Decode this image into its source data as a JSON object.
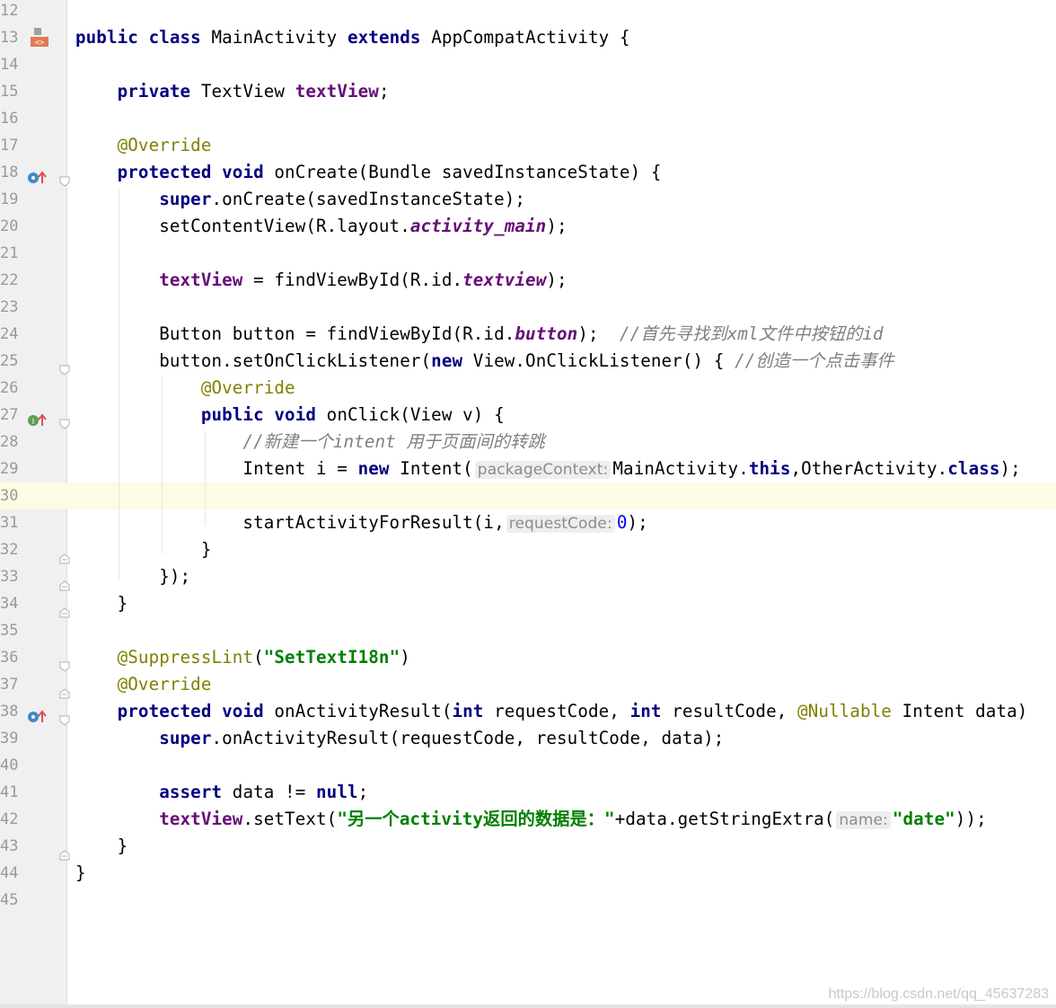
{
  "editor": {
    "first_line_number": 12,
    "current_line": 30,
    "lines": [
      {
        "n": "12",
        "tokens": []
      },
      {
        "n": "13",
        "tokens": [
          [
            "kw",
            "public"
          ],
          [
            "",
            " "
          ],
          [
            "kw",
            "class"
          ],
          [
            "",
            " MainActivity "
          ],
          [
            "kw",
            "extends"
          ],
          [
            "",
            " AppCompatActivity {"
          ]
        ],
        "gutter": "class-icon"
      },
      {
        "n": "14",
        "tokens": []
      },
      {
        "n": "15",
        "tokens": [
          [
            "",
            "    "
          ],
          [
            "kw",
            "private"
          ],
          [
            "",
            " TextView "
          ],
          [
            "field",
            "textView"
          ],
          [
            "",
            ";"
          ]
        ]
      },
      {
        "n": "16",
        "tokens": []
      },
      {
        "n": "17",
        "tokens": [
          [
            "",
            "    "
          ],
          [
            "ann",
            "@Override"
          ]
        ]
      },
      {
        "n": "18",
        "tokens": [
          [
            "",
            "    "
          ],
          [
            "kw",
            "protected"
          ],
          [
            "",
            " "
          ],
          [
            "kw",
            "void"
          ],
          [
            "",
            " onCreate(Bundle savedInstanceState) {"
          ]
        ],
        "gutter": "override-icon",
        "fold": "fold-open"
      },
      {
        "n": "19",
        "tokens": [
          [
            "",
            "        "
          ],
          [
            "kw",
            "super"
          ],
          [
            "",
            ".onCreate(savedInstanceState);"
          ]
        ]
      },
      {
        "n": "20",
        "tokens": [
          [
            "",
            "        setContentView(R.layout."
          ],
          [
            "sfield",
            "activity_main"
          ],
          [
            "",
            ");"
          ]
        ]
      },
      {
        "n": "21",
        "tokens": []
      },
      {
        "n": "22",
        "tokens": [
          [
            "",
            "        "
          ],
          [
            "field",
            "textView"
          ],
          [
            "",
            " = findViewById(R.id."
          ],
          [
            "sfield",
            "textview"
          ],
          [
            "",
            ");"
          ]
        ]
      },
      {
        "n": "23",
        "tokens": []
      },
      {
        "n": "24",
        "tokens": [
          [
            "",
            "        Button button = findViewById(R.id."
          ],
          [
            "sfield",
            "button"
          ],
          [
            "",
            ");  "
          ],
          [
            "cm",
            "//首先寻找到xml文件中按钮的id"
          ]
        ]
      },
      {
        "n": "25",
        "tokens": [
          [
            "",
            "        button.setOnClickListener("
          ],
          [
            "kw",
            "new"
          ],
          [
            "",
            " View.OnClickListener() { "
          ],
          [
            "cm",
            "//创造一个点击事件"
          ]
        ],
        "fold": "fold-open"
      },
      {
        "n": "26",
        "tokens": [
          [
            "",
            "            "
          ],
          [
            "ann",
            "@Override"
          ]
        ]
      },
      {
        "n": "27",
        "tokens": [
          [
            "",
            "            "
          ],
          [
            "kw",
            "public"
          ],
          [
            "",
            " "
          ],
          [
            "kw",
            "void"
          ],
          [
            "",
            " onClick(View v) {"
          ]
        ],
        "gutter": "implement-icon",
        "fold": "fold-open"
      },
      {
        "n": "28",
        "tokens": [
          [
            "",
            "                "
          ],
          [
            "cm",
            "//新建一个intent 用于页面间的转跳"
          ]
        ]
      },
      {
        "n": "29",
        "tokens": [
          [
            "",
            "                Intent i = "
          ],
          [
            "kw",
            "new"
          ],
          [
            "",
            " Intent("
          ],
          [
            "hint",
            "packageContext:"
          ],
          [
            "",
            "MainActivity."
          ],
          [
            "kw",
            "this"
          ],
          [
            "",
            ",OtherActivity."
          ],
          [
            "kw",
            "class"
          ],
          [
            "",
            ");"
          ]
        ]
      },
      {
        "n": "30",
        "tokens": []
      },
      {
        "n": "31",
        "tokens": [
          [
            "",
            "                startActivityForResult(i,"
          ],
          [
            "hint",
            "requestCode:"
          ],
          [
            "num",
            "0"
          ],
          [
            "",
            ");"
          ]
        ]
      },
      {
        "n": "32",
        "tokens": [
          [
            "",
            "            }"
          ]
        ],
        "fold": "fold-close"
      },
      {
        "n": "33",
        "tokens": [
          [
            "",
            "        });"
          ]
        ],
        "fold": "fold-close"
      },
      {
        "n": "34",
        "tokens": [
          [
            "",
            "    }"
          ]
        ],
        "fold": "fold-close"
      },
      {
        "n": "35",
        "tokens": []
      },
      {
        "n": "36",
        "tokens": [
          [
            "",
            "    "
          ],
          [
            "ann",
            "@SuppressLint"
          ],
          [
            "",
            "("
          ],
          [
            "str",
            "\"SetTextI18n\""
          ],
          [
            "",
            ")"
          ]
        ],
        "fold": "fold-open"
      },
      {
        "n": "37",
        "tokens": [
          [
            "",
            "    "
          ],
          [
            "ann",
            "@Override"
          ]
        ],
        "fold": "fold-close"
      },
      {
        "n": "38",
        "tokens": [
          [
            "",
            "    "
          ],
          [
            "kw",
            "protected"
          ],
          [
            "",
            " "
          ],
          [
            "kw",
            "void"
          ],
          [
            "",
            " onActivityResult("
          ],
          [
            "kw",
            "int"
          ],
          [
            "",
            " requestCode, "
          ],
          [
            "kw",
            "int"
          ],
          [
            "",
            " resultCode, "
          ],
          [
            "ann",
            "@Nullable"
          ],
          [
            "",
            " Intent data)"
          ]
        ],
        "gutter": "override-icon",
        "fold": "fold-open"
      },
      {
        "n": "39",
        "tokens": [
          [
            "",
            "        "
          ],
          [
            "kw",
            "super"
          ],
          [
            "",
            ".onActivityResult(requestCode, resultCode, data);"
          ]
        ]
      },
      {
        "n": "40",
        "tokens": []
      },
      {
        "n": "41",
        "tokens": [
          [
            "",
            "        "
          ],
          [
            "kw",
            "assert"
          ],
          [
            "",
            " data != "
          ],
          [
            "kw",
            "null"
          ],
          [
            "",
            ";"
          ]
        ]
      },
      {
        "n": "42",
        "tokens": [
          [
            "",
            "        "
          ],
          [
            "field",
            "textView"
          ],
          [
            "",
            ".setText("
          ],
          [
            "str",
            "\"另一个activity返回的数据是：\""
          ],
          [
            "",
            "+data.getStringExtra("
          ],
          [
            "hint",
            "name:"
          ],
          [
            "str",
            "\"date\""
          ],
          [
            "",
            "));"
          ]
        ]
      },
      {
        "n": "43",
        "tokens": [
          [
            "",
            "    }"
          ]
        ],
        "fold": "fold-close"
      },
      {
        "n": "44",
        "tokens": [
          [
            "",
            "}"
          ]
        ]
      },
      {
        "n": "45",
        "tokens": []
      }
    ]
  },
  "colors": {
    "keyword": "#000080",
    "annotation": "#808000",
    "field": "#660e7a",
    "string": "#008000",
    "number": "#0000ff",
    "comment": "#808080",
    "current_line": "#fefae3",
    "gutter": "#f0f0f0"
  },
  "watermark": "https://blog.csdn.net/qq_45637283"
}
